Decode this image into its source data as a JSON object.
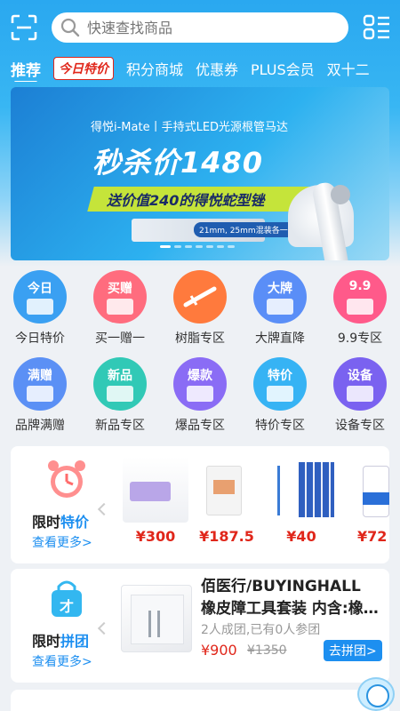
{
  "search": {
    "placeholder": "快速查找商品"
  },
  "tabs": [
    "推荐",
    "今日特价",
    "积分商城",
    "优惠券",
    "PLUS会员",
    "双十二"
  ],
  "banner": {
    "subtitle": "得悦i-Mate丨手持式LED光源根管马达",
    "title": "秒杀价1480",
    "strip": "送价值240的得悦蛇型锉",
    "box_label": "21mm, 25mm混装各一板"
  },
  "categories": [
    {
      "label": "今日特价",
      "badge": "今日",
      "color": "#3aa0f2",
      "icon": "calendar-icon"
    },
    {
      "label": "买一赠一",
      "badge": "买赠",
      "color": "#ff6c7e",
      "icon": "gift-icon"
    },
    {
      "label": "树脂专区",
      "badge": "",
      "color": "#ff7a3d",
      "icon": "syringe-icon"
    },
    {
      "label": "大牌直降",
      "badge": "大牌",
      "color": "#5a8ef7",
      "icon": "bag-icon"
    },
    {
      "label": "9.9专区",
      "badge": "9.9",
      "color": "#ff5a8a",
      "icon": "box-icon"
    },
    {
      "label": "品牌满赠",
      "badge": "满赠",
      "color": "#5b90f5",
      "icon": "box-open-icon"
    },
    {
      "label": "新品专区",
      "badge": "新品",
      "color": "#31c9b6",
      "icon": "new-box-icon"
    },
    {
      "label": "爆品专区",
      "badge": "爆款",
      "color": "#8a6cf5",
      "icon": "fire-icon"
    },
    {
      "label": "特价专区",
      "badge": "特价",
      "color": "#36b3f4",
      "icon": "ticket-icon"
    },
    {
      "label": "设备专区",
      "badge": "设备",
      "color": "#7a62f0",
      "icon": "device-icon"
    }
  ],
  "flash": {
    "title_a": "限时",
    "title_b": "特价",
    "more": "查看更多>",
    "products": [
      {
        "price": "¥300"
      },
      {
        "price": "¥187.5"
      },
      {
        "price": "¥40"
      },
      {
        "price": "¥72"
      }
    ]
  },
  "group": {
    "title_a": "限时",
    "title_b": "拼团",
    "more": "查看更多>",
    "product_title": "佰医行/BUYINGHALL 橡皮障工具套装 内含:橡…",
    "sub": "2人成团,已有0人参团",
    "price": "¥900",
    "old_price": "¥1350",
    "button": "去拼团>"
  }
}
